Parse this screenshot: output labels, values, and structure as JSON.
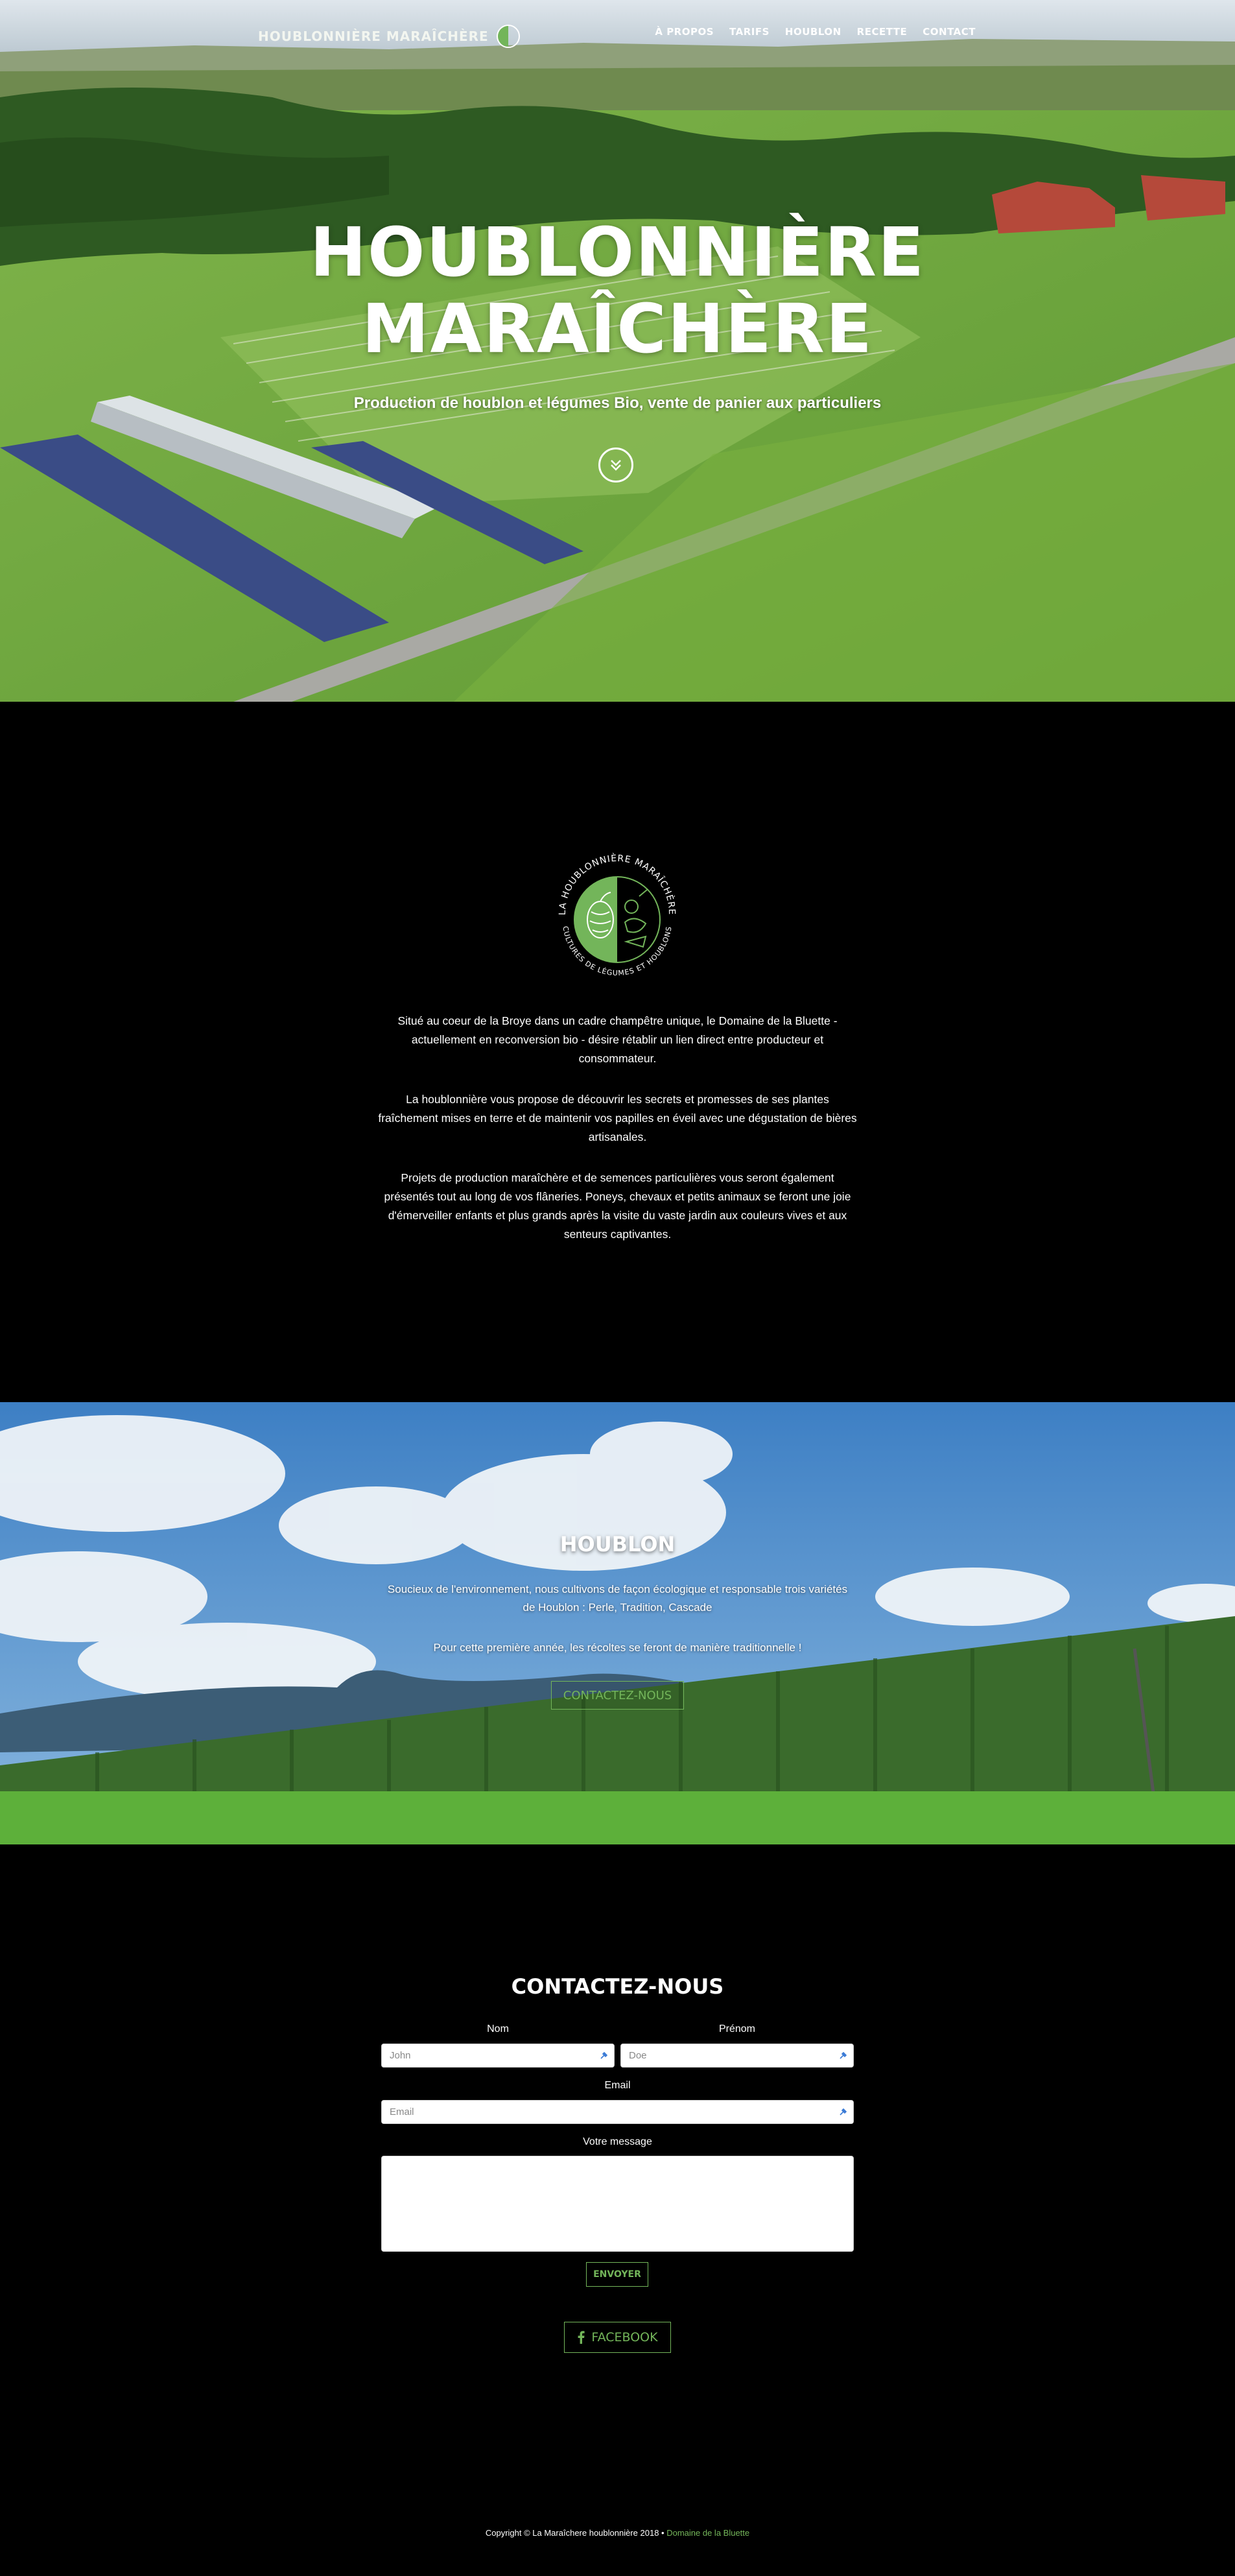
{
  "nav": {
    "brand": "HOUBLONNIÈRE MARAÎCHÈRE",
    "items": [
      {
        "label": "À PROPOS"
      },
      {
        "label": "TARIFS"
      },
      {
        "label": "HOUBLON"
      },
      {
        "label": "RECETTE"
      },
      {
        "label": "CONTACT"
      }
    ]
  },
  "hero": {
    "title_line1": "HOUBLONNIÈRE",
    "title_line2": "MARAÎCHÈRE",
    "subtitle": "Production de houblon et légumes Bio, vente de panier aux particuliers",
    "scroll_icon": "chevron-double-down-icon"
  },
  "about": {
    "logo_top_text": "LA HOUBLONNIÈRE MARAÎCHÈRE",
    "logo_bottom_text": "CULTURES DE LÉGUMES ET HOUBLONS",
    "paragraphs": [
      "Situé au coeur de la Broye dans un cadre champêtre unique, le Domaine de la Bluette - actuellement en reconversion bio - désire rétablir un lien direct entre producteur et consommateur.",
      "La houblonnière vous propose de découvrir les secrets et promesses de ses plantes fraîchement mises en terre et de maintenir vos papilles en éveil avec une dégustation de bières artisanales.",
      "Projets de production maraîchère et de semences particulières vous seront également présentés tout au long de vos flâneries. Poneys, chevaux et petits animaux se feront une joie d'émerveiller enfants et plus grands après la visite du vaste jardin aux couleurs vives et aux senteurs captivantes."
    ]
  },
  "houblon": {
    "title": "HOUBLON",
    "paragraphs": [
      "Soucieux de l'environnement, nous cultivons de façon écologique et responsable trois variétés de Houblon : Perle, Tradition, Cascade",
      "Pour cette première année, les récoltes se feront de manière traditionnelle !"
    ],
    "button": "CONTACTEZ-NOUS"
  },
  "contact": {
    "title": "CONTACTEZ-NOUS",
    "nom_label": "Nom",
    "nom_placeholder": "John",
    "prenom_label": "Prénom",
    "prenom_placeholder": "Doe",
    "email_label": "Email",
    "email_placeholder": "Email",
    "message_label": "Votre message",
    "send_button": "ENVOYER",
    "facebook_button": "FACEBOOK"
  },
  "footer": {
    "copyright": "Copyright © La Maraîchere houblonnière 2018 •",
    "link": "Domaine de la Bluette"
  },
  "colors": {
    "accent": "#73b55a",
    "background": "#000000"
  }
}
